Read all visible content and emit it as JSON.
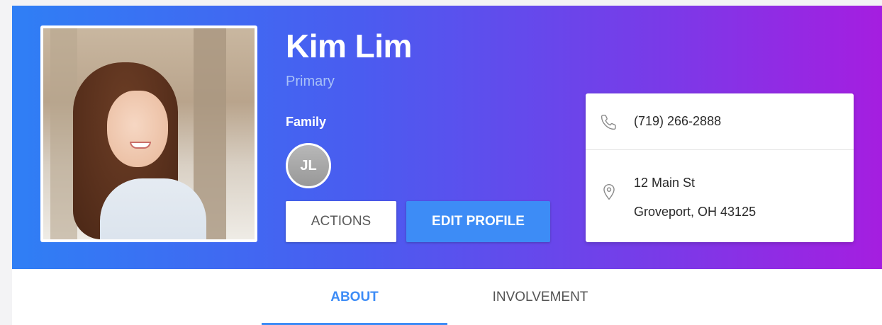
{
  "profile": {
    "name": "Kim Lim",
    "role": "Primary",
    "family_label": "Family",
    "family_members": [
      {
        "initials": "JL"
      }
    ]
  },
  "actions": {
    "actions_label": "ACTIONS",
    "edit_profile_label": "EDIT PROFILE"
  },
  "contact": {
    "phone": "(719) 266-2888",
    "address_line1": "12 Main St",
    "address_line2": "Groveport, OH 43125",
    "phone_icon": "phone-icon",
    "address_icon": "map-pin-icon"
  },
  "tabs": [
    {
      "label": "ABOUT",
      "active": true
    },
    {
      "label": "INVOLVEMENT",
      "active": false
    }
  ],
  "colors": {
    "accent": "#3d8cf6",
    "gradient_start": "#2f7ff5",
    "gradient_end": "#a51ee0"
  }
}
